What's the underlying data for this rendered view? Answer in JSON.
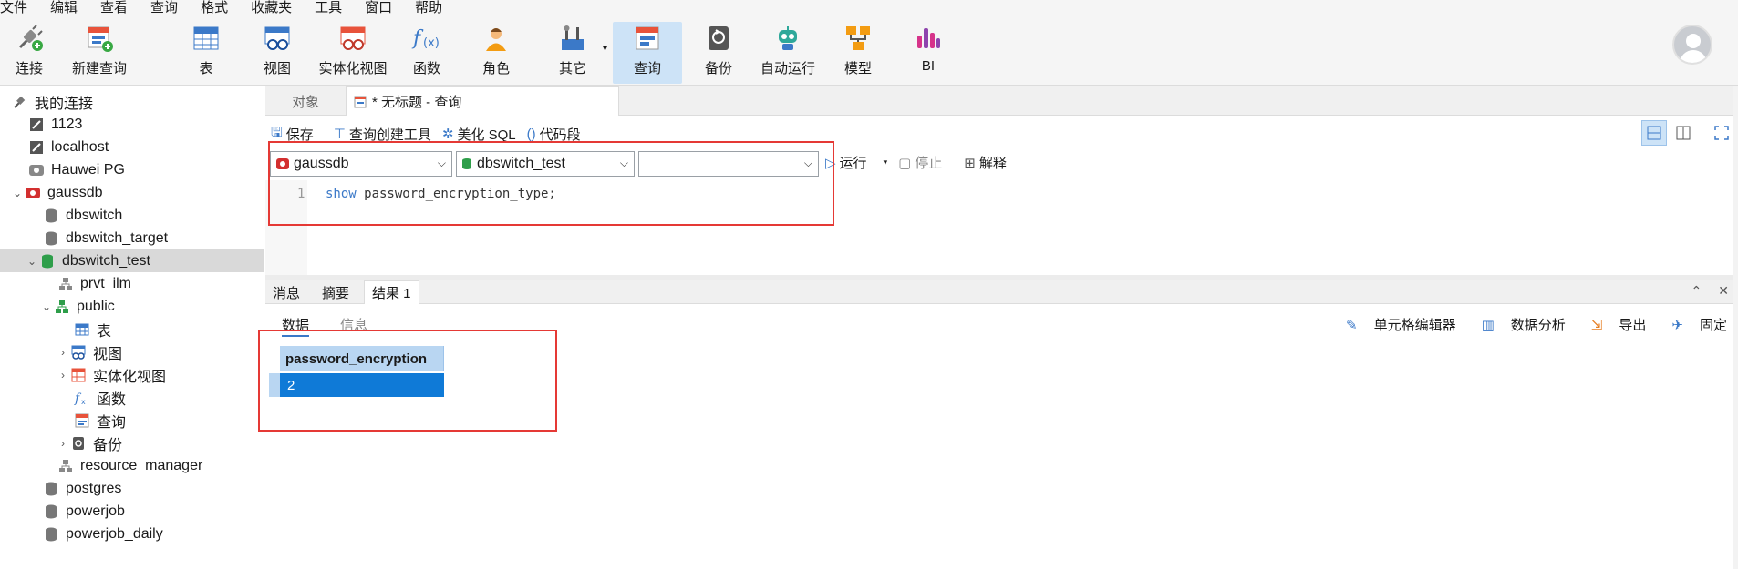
{
  "menu": [
    "文件",
    "编辑",
    "查看",
    "查询",
    "格式",
    "收藏夹",
    "工具",
    "窗口",
    "帮助"
  ],
  "toolbar": {
    "connect": "连接",
    "new_query": "新建查询",
    "table": "表",
    "view": "视图",
    "mat_view": "实体化视图",
    "function": "函数",
    "role": "角色",
    "other": "其它",
    "query": "查询",
    "backup": "备份",
    "auto_run": "自动运行",
    "model": "模型",
    "bi": "BI"
  },
  "sidebar": {
    "root": "我的连接",
    "items": [
      {
        "label": "1123"
      },
      {
        "label": "localhost"
      },
      {
        "label": "Hauwei PG"
      },
      {
        "label": "gaussdb"
      },
      {
        "label": "dbswitch"
      },
      {
        "label": "dbswitch_target"
      },
      {
        "label": "dbswitch_test"
      },
      {
        "label": "prvt_ilm"
      },
      {
        "label": "public"
      },
      {
        "label": "表"
      },
      {
        "label": "视图"
      },
      {
        "label": "实体化视图"
      },
      {
        "label": "函数"
      },
      {
        "label": "查询"
      },
      {
        "label": "备份"
      },
      {
        "label": "resource_manager"
      },
      {
        "label": "postgres"
      },
      {
        "label": "powerjob"
      },
      {
        "label": "powerjob_daily"
      }
    ]
  },
  "tabs": {
    "objects": "对象",
    "query": "* 无标题 - 查询"
  },
  "query_tools": {
    "save": "保存",
    "builder": "查询创建工具",
    "beautify": "美化 SQL",
    "snippet": "代码段"
  },
  "selectors": {
    "connection": "gaussdb",
    "database": "dbswitch_test",
    "schema": ""
  },
  "run_tools": {
    "run": "运行",
    "stop": "停止",
    "explain": "解释"
  },
  "editor": {
    "line": "1",
    "keyword": "show",
    "rest": " password_encryption_type;"
  },
  "result_tabs": {
    "messages": "消息",
    "summary": "摘要",
    "result1": "结果 1"
  },
  "sub_tabs": {
    "data": "数据",
    "info": "信息"
  },
  "result_tools": {
    "cell_editor": "单元格编辑器",
    "analysis": "数据分析",
    "export": "导出",
    "pin": "固定"
  },
  "grid": {
    "column": "password_encryption",
    "value": "2"
  }
}
